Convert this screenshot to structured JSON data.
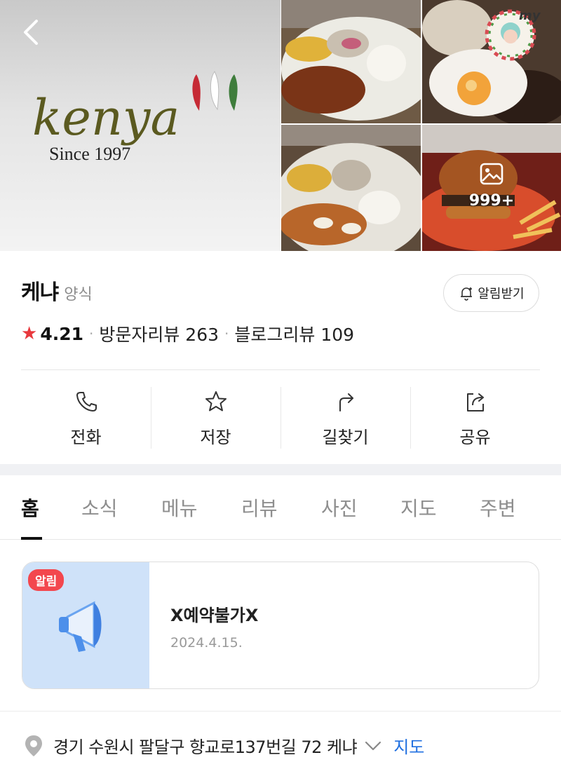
{
  "header": {
    "back_icon": "chevron-left-icon",
    "logo": {
      "brand_text": "kenya",
      "since_text": "Since 1997"
    },
    "photo_count": "999+",
    "my_badge_label": "my"
  },
  "place": {
    "name": "케냐",
    "category": "양식",
    "notify_label": "알림받기",
    "rating": "4.21",
    "visitor_review_label": "방문자리뷰 263",
    "blog_review_label": "블로그리뷰 109"
  },
  "actions": [
    {
      "label": "전화",
      "icon": "phone-icon"
    },
    {
      "label": "저장",
      "icon": "star-outline-icon"
    },
    {
      "label": "길찾기",
      "icon": "directions-icon"
    },
    {
      "label": "공유",
      "icon": "share-icon"
    }
  ],
  "tabs": [
    "홈",
    "소식",
    "메뉴",
    "리뷰",
    "사진",
    "지도",
    "주변"
  ],
  "active_tab": "홈",
  "notice": {
    "badge": "알림",
    "title": "X예약불가X",
    "date": "2024.4.15."
  },
  "address": {
    "text": "경기 수원시 팔달구 향교로137번길 72 케냐",
    "map_label": "지도"
  },
  "colors": {
    "accent_star": "#e8383d",
    "notice_badge": "#f3474e",
    "notice_thumb_bg": "#cfe2f9",
    "link_blue": "#1f6fe0"
  }
}
